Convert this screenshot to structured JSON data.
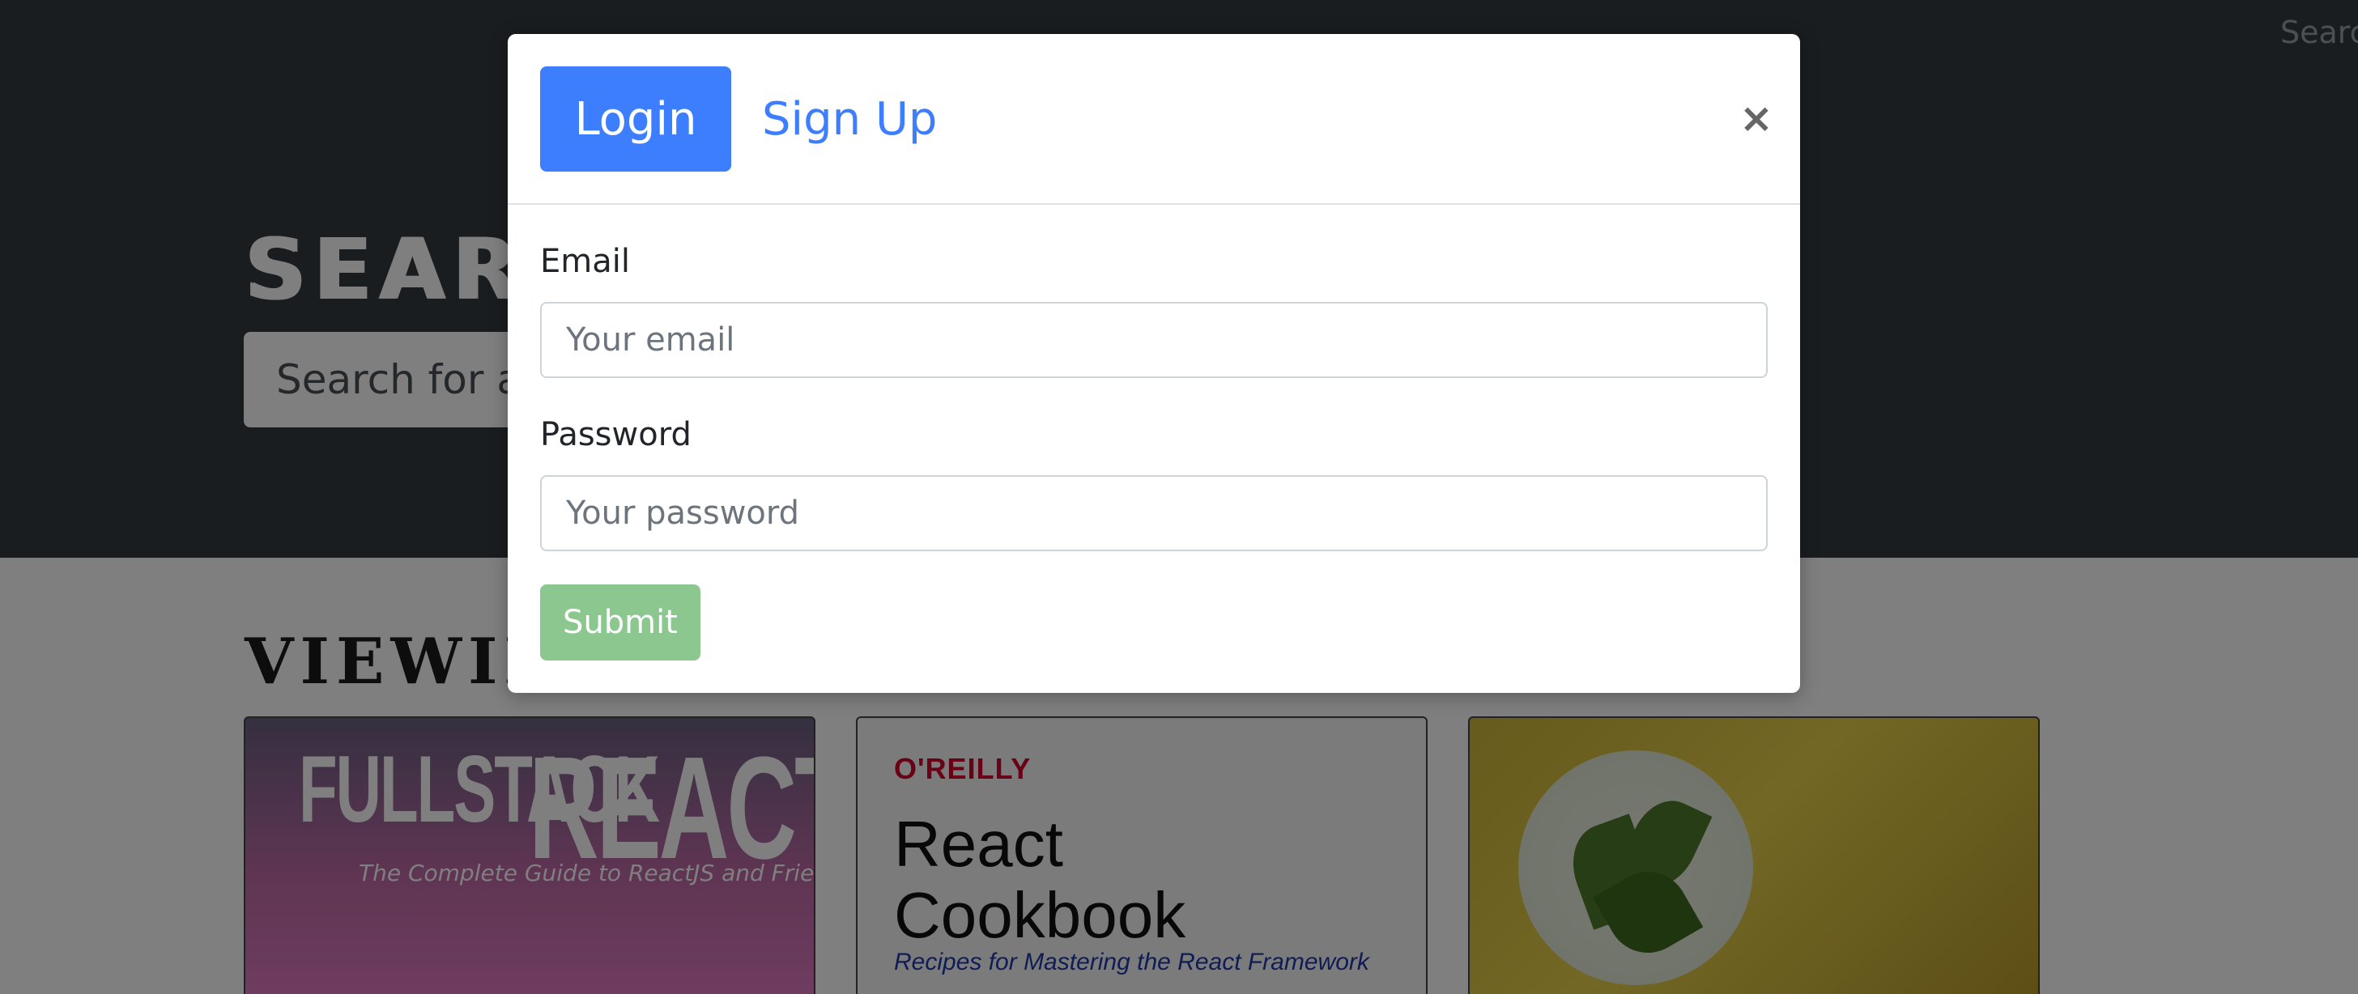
{
  "nav": {
    "search_label": "Searc"
  },
  "hero": {
    "title": "SEARCH",
    "search_placeholder": "Search for a book"
  },
  "content": {
    "section_title": "VIEWING"
  },
  "books": [
    {
      "cover_title_1": "FULLSTACK",
      "cover_title_2": "REACT",
      "cover_subtitle": "The Complete Guide to ReactJS and Friends"
    },
    {
      "publisher": "O'REILLY",
      "cover_title_1": "React",
      "cover_title_2": "Cookbook",
      "cover_subtitle": "Recipes for Mastering the React Framework"
    },
    {
      "cover_image": "plant-illustration"
    }
  ],
  "modal": {
    "tabs": {
      "login": "Login",
      "signup": "Sign Up"
    },
    "close_glyph": "×",
    "email": {
      "label": "Email",
      "placeholder": "Your email",
      "value": ""
    },
    "password": {
      "label": "Password",
      "placeholder": "Your password",
      "value": ""
    },
    "submit_label": "Submit"
  },
  "colors": {
    "primary": "#3d7eff",
    "submit_disabled": "#8cc78f",
    "hero_bg": "#343a40"
  }
}
